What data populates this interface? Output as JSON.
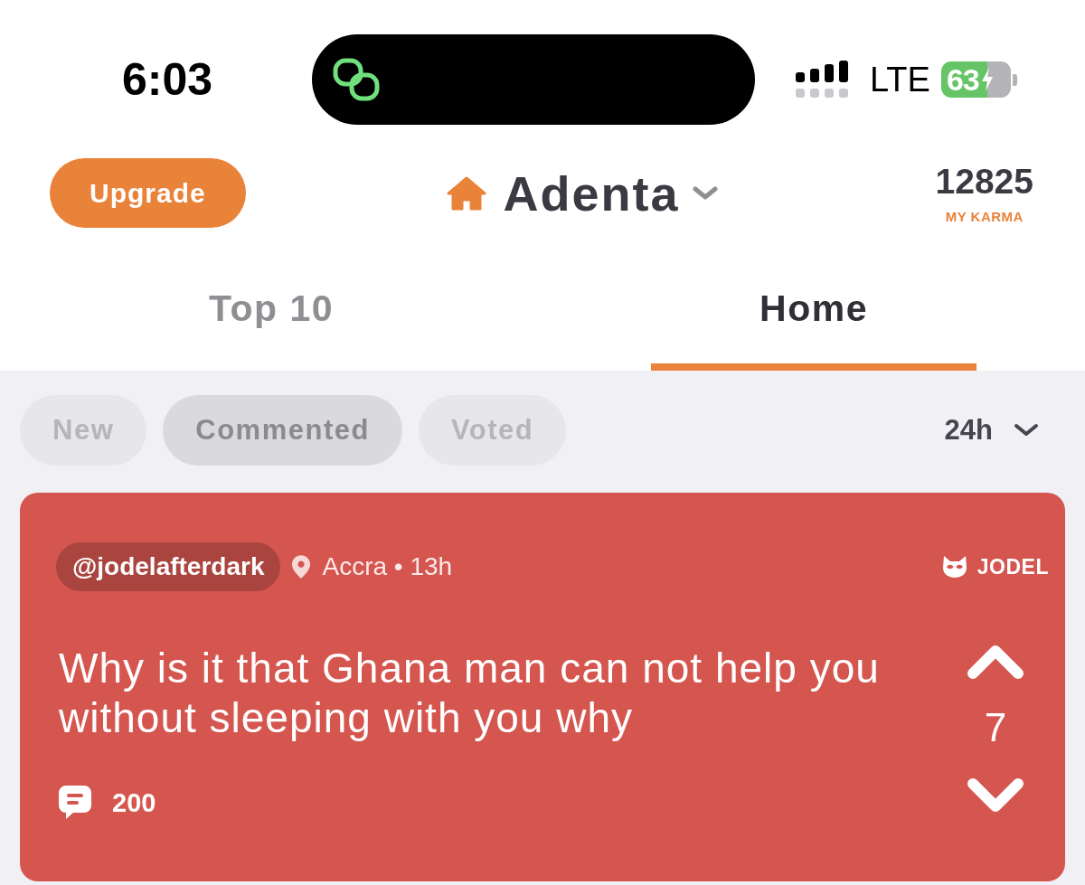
{
  "status_bar": {
    "time": "6:03",
    "network": "LTE",
    "battery": "63",
    "charging": true
  },
  "header": {
    "upgrade_button": "Upgrade",
    "location": "Adenta",
    "karma": "12825",
    "karma_label": "MY KARMA"
  },
  "tabs": [
    {
      "label": "Top 10",
      "selected": false
    },
    {
      "label": "Home",
      "selected": true
    }
  ],
  "filters": [
    {
      "label": "New",
      "selected": false
    },
    {
      "label": "Commented",
      "selected": true
    },
    {
      "label": "Voted",
      "selected": false
    }
  ],
  "time_filter": "24h",
  "posts": [
    {
      "author": "@jodelafterdark",
      "location_and_age": "Accra • 13h",
      "brand": "JODEL",
      "text": "Why is it that Ghana man can not help you without sleeping with you why",
      "votes": "7",
      "comments": "200",
      "color": "#d5554f"
    }
  ]
}
